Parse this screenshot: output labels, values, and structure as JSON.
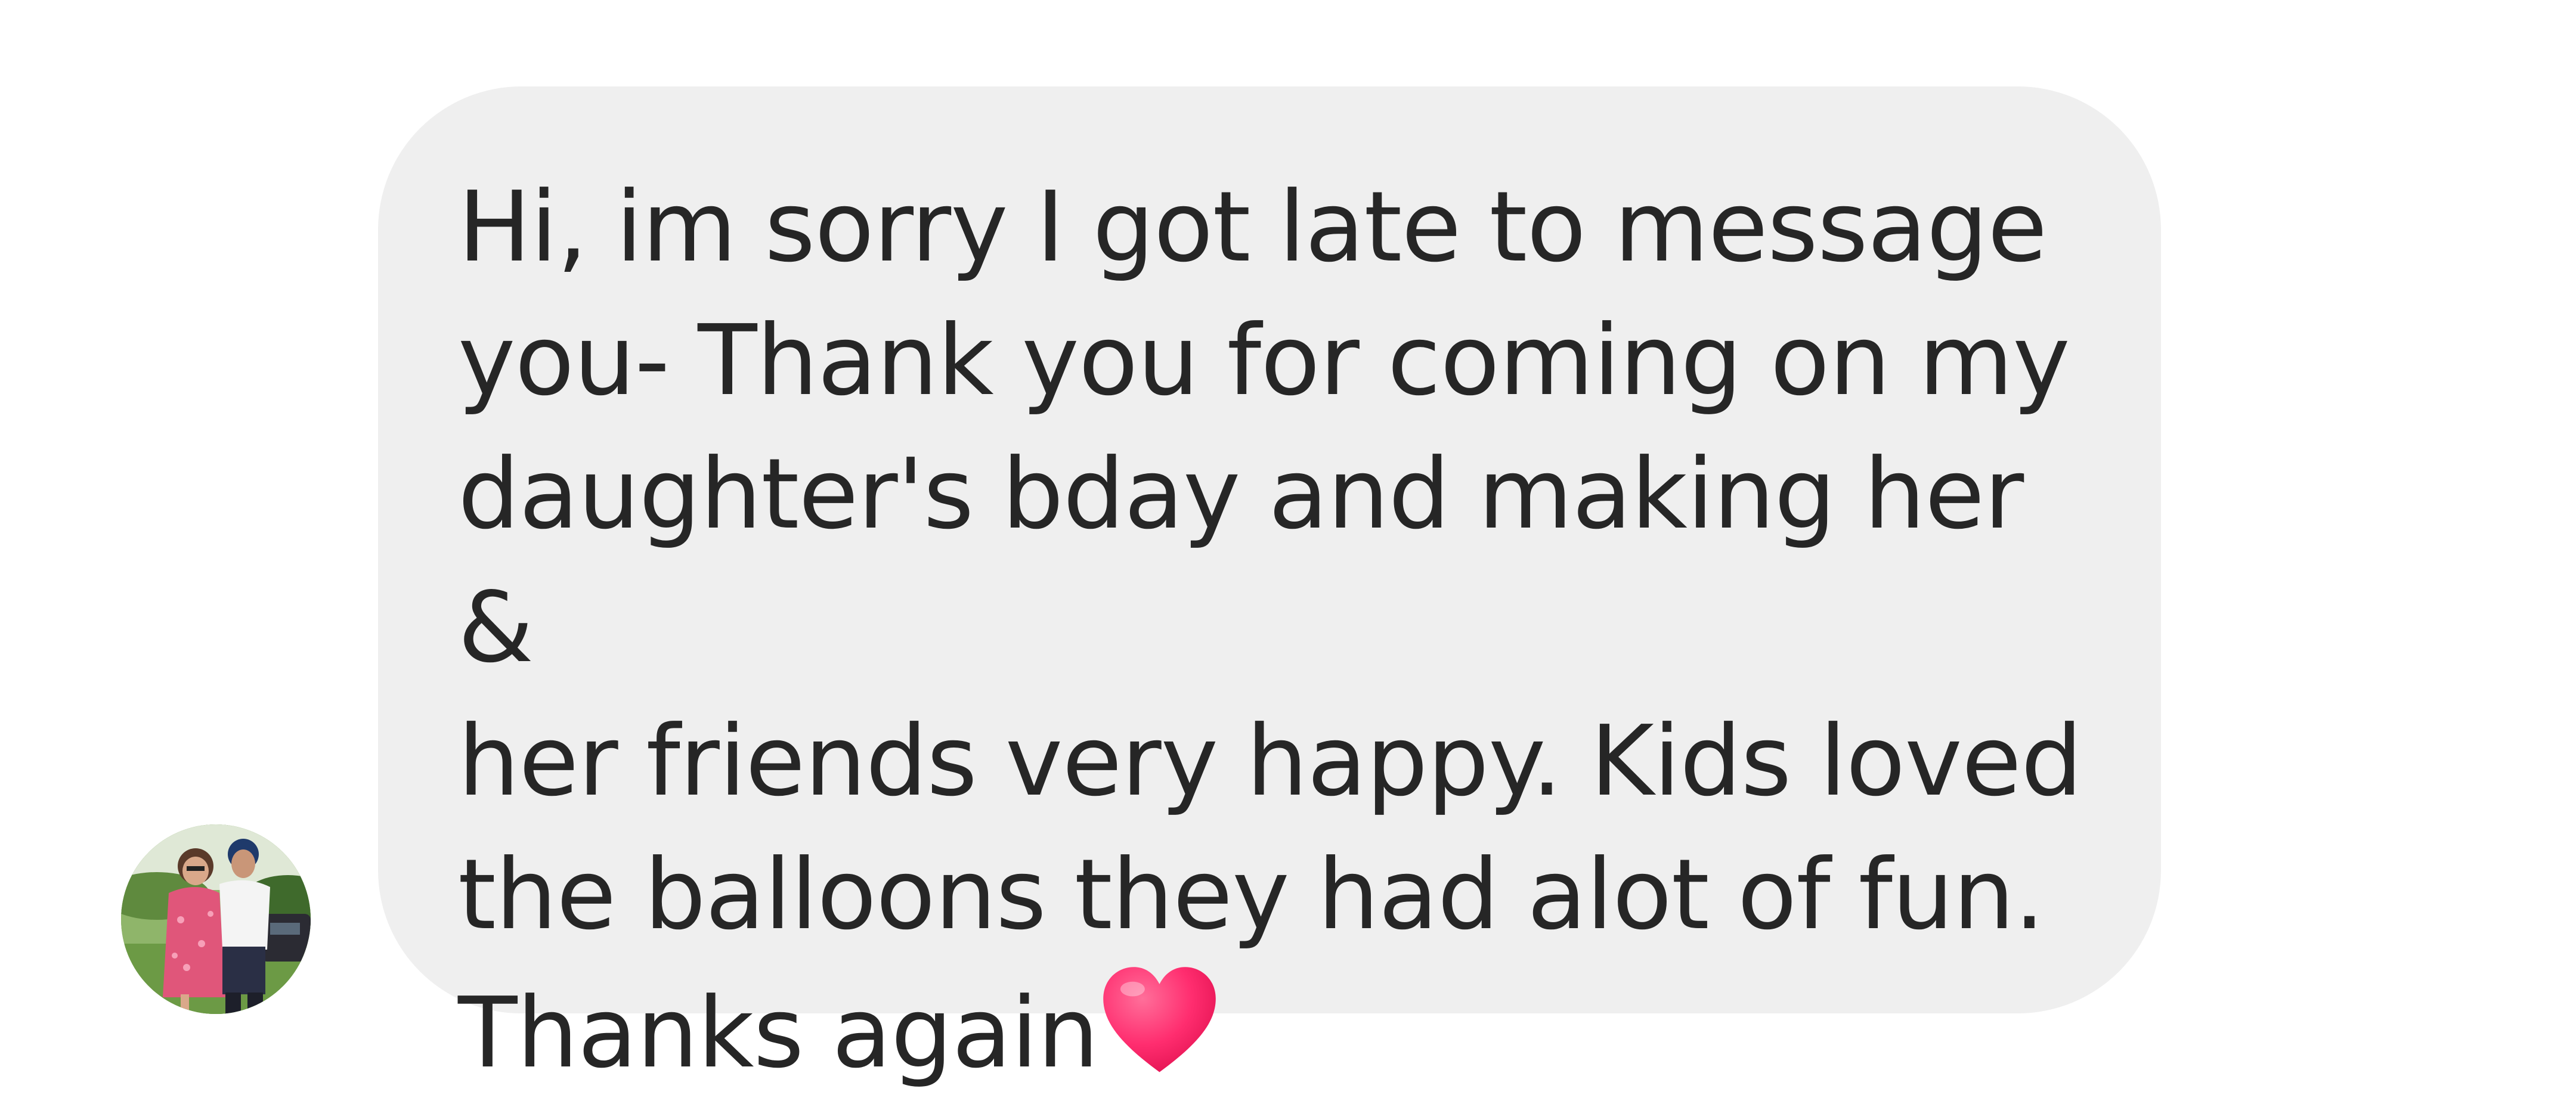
{
  "conversation": {
    "sender": {
      "avatar_icon": "profile-photo-avatar"
    },
    "message": {
      "text": "Hi, im sorry I got late to message\nyou- Thank you for coming on my\ndaughter's bday and making her &\nher friends very happy. Kids loved\nthe balloons they had alot of fun.\nThanks again",
      "emoji": "red-heart-icon"
    }
  },
  "colors": {
    "bubble_background": "#efefef",
    "text": "#262626",
    "heart": "#ff2d6f",
    "page_background": "#ffffff"
  }
}
